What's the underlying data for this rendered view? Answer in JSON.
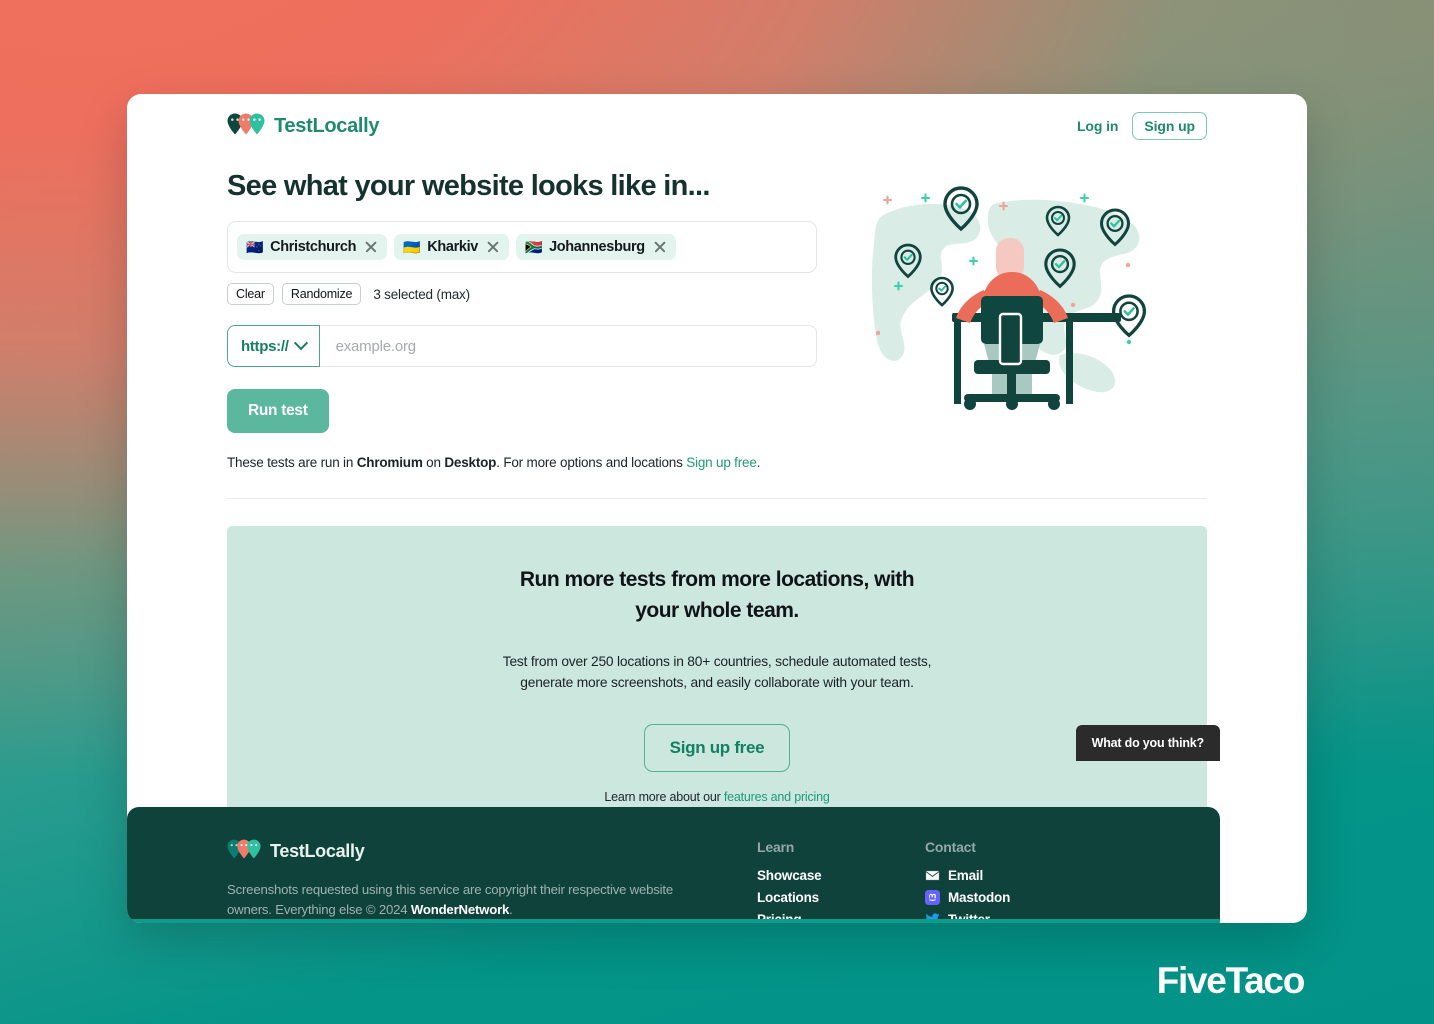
{
  "header": {
    "brand_name": "TestLocally",
    "brand_logo_icon": "map-pins-logo",
    "login_label": "Log in",
    "signup_label": "Sign up"
  },
  "hero": {
    "title": "See what your website looks like in...",
    "tags": [
      {
        "flag": "🇳🇿",
        "label": "Christchurch"
      },
      {
        "flag": "🇺🇦",
        "label": "Kharkiv"
      },
      {
        "flag": "🇿🇦",
        "label": "Johannesburg"
      }
    ],
    "clear_label": "Clear",
    "randomize_label": "Randomize",
    "selected_note": "3 selected (max)",
    "scheme_value": "https://",
    "url_placeholder": "example.org",
    "url_value": "",
    "run_label": "Run test",
    "fineprint": {
      "part1": "These tests are run in ",
      "browser": "Chromium",
      "part2": " on ",
      "device": "Desktop",
      "part3": ". For more options and locations ",
      "link": "Sign up free",
      "part4": "."
    },
    "illustration_icon": "person-at-desk-world-map-pins"
  },
  "promo": {
    "heading": "Run more tests from more locations, with your whole team.",
    "subtext": "Test from over 250 locations in 80+ countries, schedule automated tests, generate more screenshots, and easily collaborate with your team.",
    "cta_label": "Sign up free",
    "learn_prefix": "Learn more about our ",
    "learn_link": "features and pricing"
  },
  "feedback": {
    "label": "What do you think?"
  },
  "footer": {
    "brand_name": "TestLocally",
    "copy_part1": "Screenshots requested using this service are copyright their respective website owners. Everything else © 2024 ",
    "copy_company": "WonderNetwork",
    "copy_part2": ".",
    "learn": {
      "heading": "Learn",
      "links": [
        "Showcase",
        "Locations",
        "Pricing"
      ]
    },
    "contact": {
      "heading": "Contact",
      "links": [
        {
          "label": "Email",
          "icon": "envelope-icon"
        },
        {
          "label": "Mastodon",
          "icon": "mastodon-icon"
        },
        {
          "label": "Twitter",
          "icon": "twitter-bird-icon"
        }
      ]
    }
  },
  "watermark": {
    "label": "FiveTaco"
  },
  "colors": {
    "brand_green": "#1f8a6d",
    "accent_teal": "#5cb79f",
    "promo_bg": "#cce7dd",
    "footer_bg": "#10423c",
    "footer_rule": "#0d9c8b",
    "coral": "#ee6f5d",
    "dark_text": "#16322e"
  }
}
